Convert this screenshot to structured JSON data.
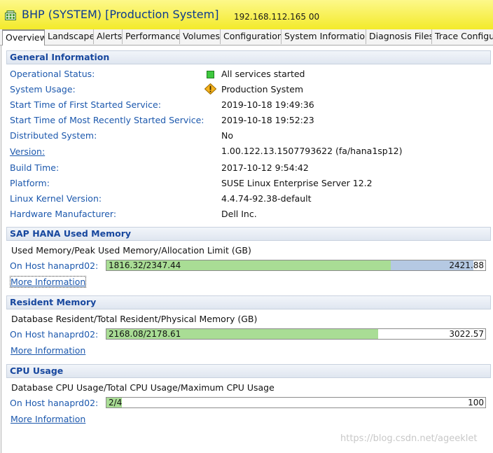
{
  "header": {
    "title": "BHP (SYSTEM) [Production System]",
    "address": "192.168.112.165 00",
    "icon": "system-db-icon"
  },
  "tabs": [
    {
      "label": "Overview",
      "active": true
    },
    {
      "label": "Landscape"
    },
    {
      "label": "Alerts"
    },
    {
      "label": "Performance"
    },
    {
      "label": "Volumes"
    },
    {
      "label": "Configuration"
    },
    {
      "label": "System Information"
    },
    {
      "label": "Diagnosis Files"
    },
    {
      "label": "Trace Configu"
    }
  ],
  "general": {
    "title": "General Information",
    "rows": [
      {
        "label": "Operational Status:",
        "value": "All services started",
        "icon": "green-square-icon"
      },
      {
        "label": "System Usage:",
        "value": "Production System",
        "icon": "warning-diamond-icon"
      },
      {
        "label": "Start Time of First Started Service:",
        "value": "2019-10-18 19:49:36"
      },
      {
        "label": "Start Time of Most Recently Started Service:",
        "value": "2019-10-18 19:52:23"
      },
      {
        "label": "Distributed System:",
        "value": "No"
      },
      {
        "label": "Version:",
        "value": "1.00.122.13.1507793622 (fa/hana1sp12)",
        "link": true
      },
      {
        "label": "Build Time:",
        "value": "2017-10-12 9:54:42"
      },
      {
        "label": "Platform:",
        "value": "SUSE Linux Enterprise Server 12.2"
      },
      {
        "label": "Linux Kernel Version:",
        "value": "4.4.74-92.38-default"
      },
      {
        "label": "Hardware Manufacturer:",
        "value": "Dell Inc."
      }
    ]
  },
  "memory": {
    "title": "SAP HANA Used Memory",
    "caption": "Used Memory/Peak Used Memory/Allocation Limit (GB)",
    "host_label": "On Host hanaprd02:",
    "bar_left": "1816.32/2347.44",
    "bar_right": "2421.88",
    "used_fraction": 0.75,
    "peak_fraction": 0.969,
    "more": "More Information"
  },
  "resident": {
    "title": "Resident Memory",
    "caption": "Database Resident/Total Resident/Physical Memory (GB)",
    "host_label": "On Host hanaprd02:",
    "bar_left": "2168.08/2178.61",
    "bar_right": "3022.57",
    "used_fraction": 0.717,
    "more": "More Information"
  },
  "cpu": {
    "title": "CPU Usage",
    "caption": "Database CPU Usage/Total CPU Usage/Maximum CPU Usage",
    "host_label": "On Host hanaprd02:",
    "bar_left": "2/4",
    "bar_right": "100",
    "used_fraction": 0.04,
    "more": "More Information"
  },
  "watermark": "https://blog.csdn.net/ageeklet",
  "colors": {
    "title_bg": "#f5ee3a",
    "link": "#1c58ad",
    "bar_green": "#a9dd95",
    "bar_blue": "#b5c9e3"
  }
}
